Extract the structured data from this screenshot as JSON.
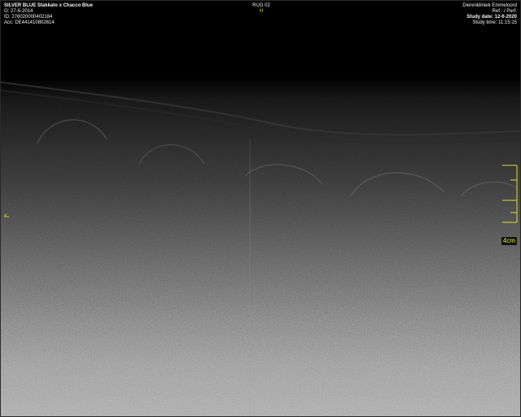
{
  "patient": {
    "name": "SILVER BLUE  Stakkato x Chacco Blue",
    "dob": "O: 27-6-2014",
    "id": "ID: 276020000402184",
    "acc": "Acc: DE441410802614"
  },
  "top_center": {
    "series": "RUG 02",
    "orientation_marker": "H"
  },
  "institution": {
    "name": "Dierenkliniek Emmeloord",
    "ref": "Ref.: / Perf.",
    "study_date": "Study date: 12-6-2020",
    "study_time": "Study time: 11:15:15"
  },
  "left_marker": "K",
  "scale": {
    "label": "4cm"
  },
  "colors": {
    "overlay_text": "#f4f4f4",
    "scale_yellow": "#d8d83a",
    "scale_box_bg": "#111111"
  },
  "icons": [
    "depth-scale-icon",
    "noise-texture"
  ]
}
